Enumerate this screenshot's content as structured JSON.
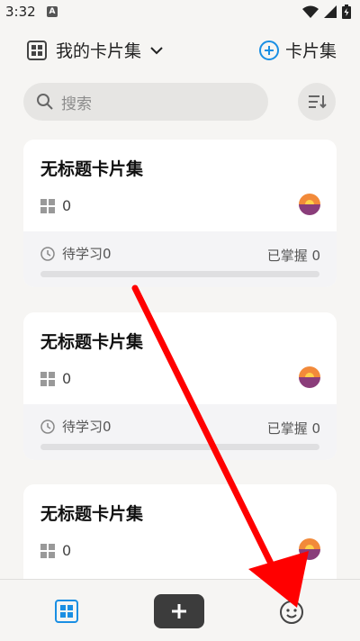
{
  "status_bar": {
    "time": "3:32",
    "notification_badge": "A"
  },
  "header": {
    "set_title": "我的卡片集",
    "add_label": "卡片集"
  },
  "search": {
    "placeholder": "搜索"
  },
  "cards": [
    {
      "title": "无标题卡片集",
      "count": "0",
      "pending": "待学习0",
      "mastered": "已掌握 0",
      "progress": 0
    },
    {
      "title": "无标题卡片集",
      "count": "0",
      "pending": "待学习0",
      "mastered": "已掌握 0",
      "progress": 0
    },
    {
      "title": "无标题卡片集",
      "count": "0"
    }
  ],
  "colors": {
    "accent": "#1a8fe3",
    "arrow": "#ff0000"
  }
}
